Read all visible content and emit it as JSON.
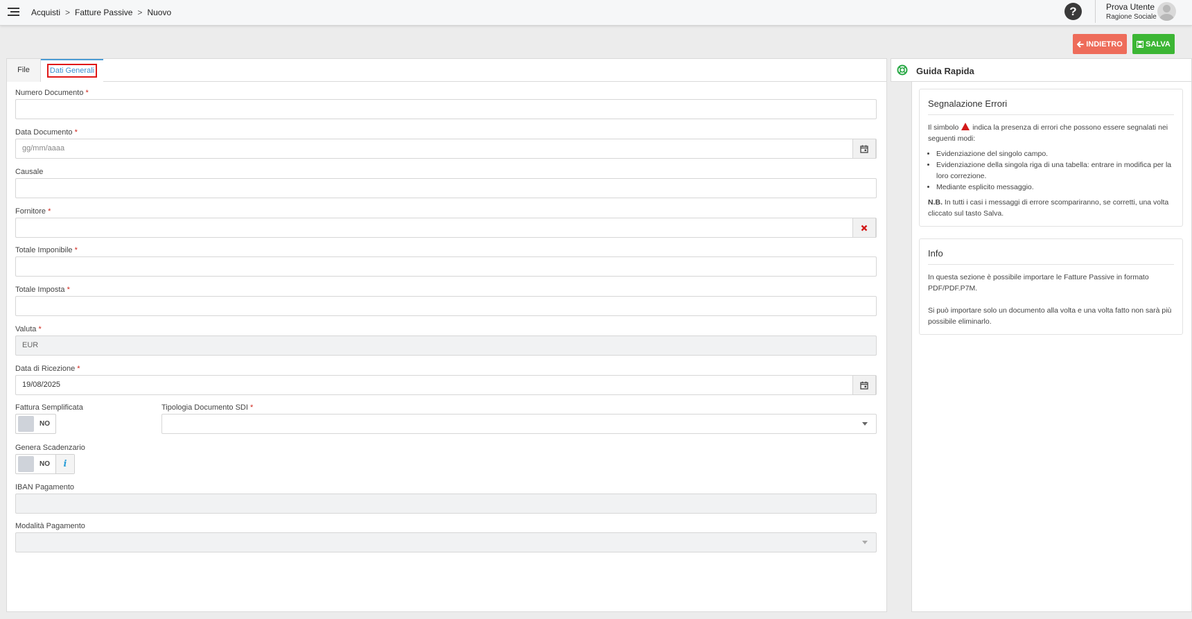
{
  "header": {
    "breadcrumb": [
      "Acquisti",
      "Fatture Passive",
      "Nuovo"
    ],
    "breadcrumb_sep": ">",
    "help_label": "?",
    "user_name": "Prova Utente",
    "user_org": "Ragione Sociale"
  },
  "actions": {
    "back_label": "INDIETRO",
    "save_label": "SALVA"
  },
  "tabs": {
    "file": "File",
    "dati_generali": "Dati Generali"
  },
  "form": {
    "numero_documento": {
      "label": "Numero Documento",
      "value": ""
    },
    "data_documento": {
      "label": "Data Documento",
      "placeholder": "gg/mm/aaaa"
    },
    "causale": {
      "label": "Causale",
      "value": ""
    },
    "fornitore": {
      "label": "Fornitore",
      "value": ""
    },
    "totale_imponibile": {
      "label": "Totale Imponibile",
      "value": ""
    },
    "totale_imposta": {
      "label": "Totale Imposta",
      "value": ""
    },
    "valuta": {
      "label": "Valuta",
      "value": "EUR"
    },
    "data_ricezione": {
      "label": "Data di Ricezione",
      "value": "19/08/2025"
    },
    "fattura_semplificata": {
      "label": "Fattura Semplificata",
      "value": "NO"
    },
    "tipologia_documento": {
      "label": "Tipologia Documento SDI",
      "value": ""
    },
    "genera_scadenzario": {
      "label": "Genera Scadenzario",
      "value": "NO"
    },
    "iban_pagamento": {
      "label": "IBAN Pagamento",
      "value": ""
    },
    "modalita_pagamento": {
      "label": "Modalità Pagamento",
      "value": ""
    },
    "required_mark": "*"
  },
  "guide": {
    "title": "Guida Rapida",
    "errors_card": {
      "title": "Segnalazione Errori",
      "intro_before": "Il simbolo",
      "intro_after": "indica la presenza di errori che possono essere segnalati nei seguenti modi:",
      "items": [
        "Evidenziazione del singolo campo.",
        "Evidenziazione della singola riga di una tabella: entrare in modifica per la loro correzione.",
        "Mediante esplicito messaggio."
      ],
      "nb_label": "N.B.",
      "nb_text": "In tutti i casi i messaggi di errore scompariranno, se corretti, una volta cliccato sul tasto Salva."
    },
    "info_card": {
      "title": "Info",
      "p1": "In questa sezione è possibile importare le Fatture Passive in formato PDF/PDF.P7M.",
      "p2": "Si può importare solo un documento alla volta e una volta fatto non sarà più possibile eliminarlo."
    }
  },
  "colors": {
    "back_button": "#ee6c5a",
    "save_button": "#3cb634",
    "active_tab": "#3b8fd0",
    "required": "#d0261c",
    "highlight_box": "#e01818"
  }
}
